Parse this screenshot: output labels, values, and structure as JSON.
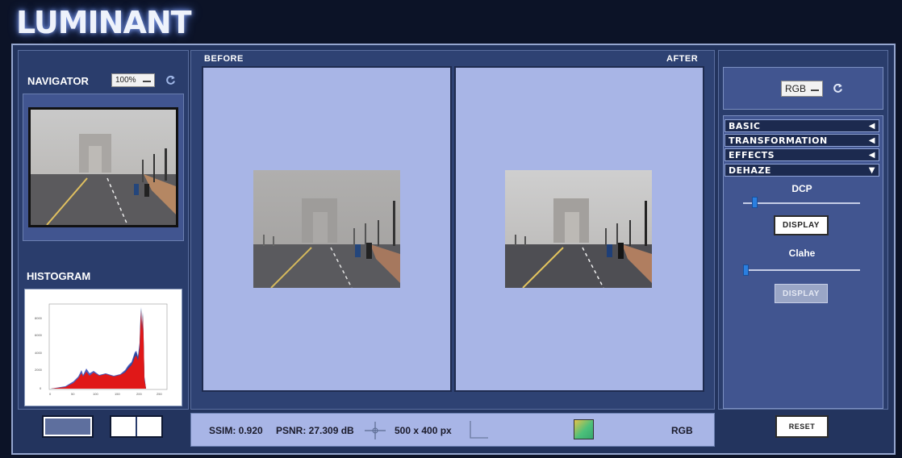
{
  "app": {
    "title": "LUMINANT"
  },
  "navigator": {
    "label": "NAVIGATOR",
    "zoom": "100%"
  },
  "histogram": {
    "label": "HISTOGRAM",
    "y_ticks": [
      "8000",
      "6000",
      "4000",
      "2000",
      "0"
    ],
    "x_ticks": [
      "0",
      "50",
      "100",
      "150",
      "200",
      "250"
    ]
  },
  "view": {
    "before_label": "BEFORE",
    "after_label": "AFTER"
  },
  "right_panel": {
    "channel": "RGB",
    "sections": [
      {
        "label": "BASIC",
        "arrow": "◀"
      },
      {
        "label": "TRANSFORMATION",
        "arrow": "◀"
      },
      {
        "label": "EFFECTS",
        "arrow": "◀"
      },
      {
        "label": "DEHAZE",
        "arrow": "▼"
      }
    ],
    "dcp": {
      "label": "DCP",
      "value": 0.08,
      "button": "DISPLAY"
    },
    "clahe": {
      "label": "Clahe",
      "value": 0.0,
      "button": "DISPLAY"
    },
    "reset": "RESET"
  },
  "status": {
    "ssim": "SSIM: 0.920",
    "psnr": "PSNR: 27.309 dB",
    "dims": "500 x 400 px",
    "mode": "RGB"
  },
  "colors": {
    "accent": "#2a7fe0",
    "panel": "#2a3d6c",
    "view_bg": "#a8b5e6"
  }
}
